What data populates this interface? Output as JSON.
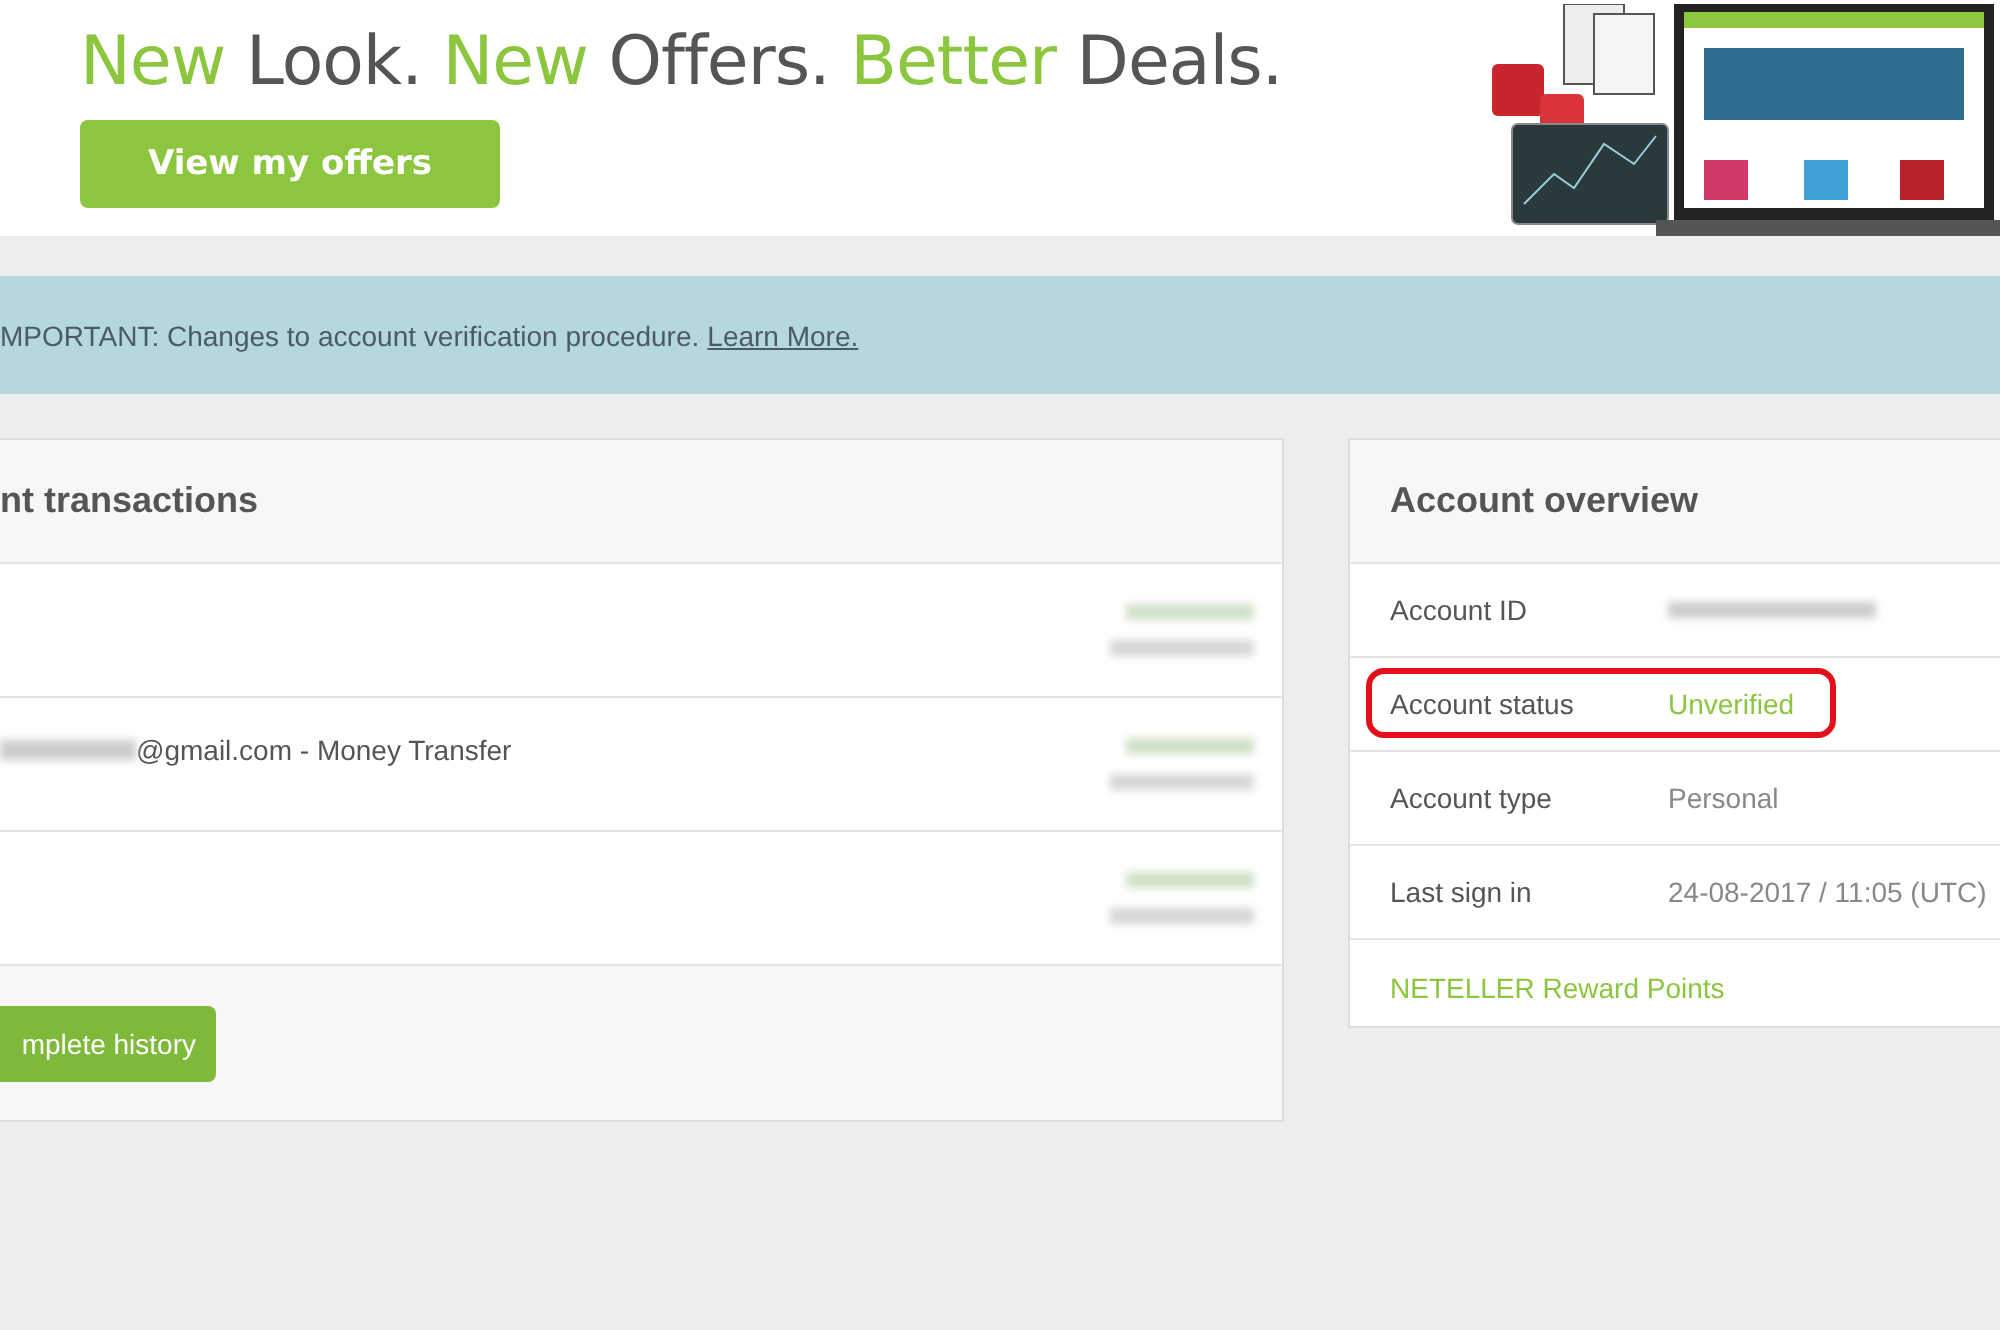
{
  "banner": {
    "headline": [
      {
        "text": "New",
        "accent": true
      },
      {
        "text": "Look.",
        "accent": false
      },
      {
        "text": "New",
        "accent": true
      },
      {
        "text": "Offers.",
        "accent": false
      },
      {
        "text": "Better",
        "accent": true
      },
      {
        "text": "Deals.",
        "accent": false
      }
    ],
    "button": "View my offers"
  },
  "notice": {
    "text": "MPORTANT: Changes to account verification procedure.",
    "link": "Learn More."
  },
  "transactions": {
    "title": "nt transactions",
    "rows": [
      {
        "redacted": true
      },
      {
        "description": "@gmail.com - Money Transfer",
        "redacted": true
      },
      {
        "redacted": true
      }
    ],
    "button": "mplete history"
  },
  "overview": {
    "title": "Account overview",
    "rows": [
      {
        "label": "Account ID",
        "kind": "redacted",
        "highlighted": false
      },
      {
        "label": "Account status",
        "value": "Unverified",
        "kind": "status",
        "highlighted": true
      },
      {
        "label": "Account type",
        "value": "Personal",
        "kind": "plain",
        "highlighted": false
      },
      {
        "label": "Last sign in",
        "value": "24-08-2017 / 11:05 (UTC)",
        "kind": "plain",
        "highlighted": false
      }
    ],
    "link": "NETELLER Reward Points"
  }
}
